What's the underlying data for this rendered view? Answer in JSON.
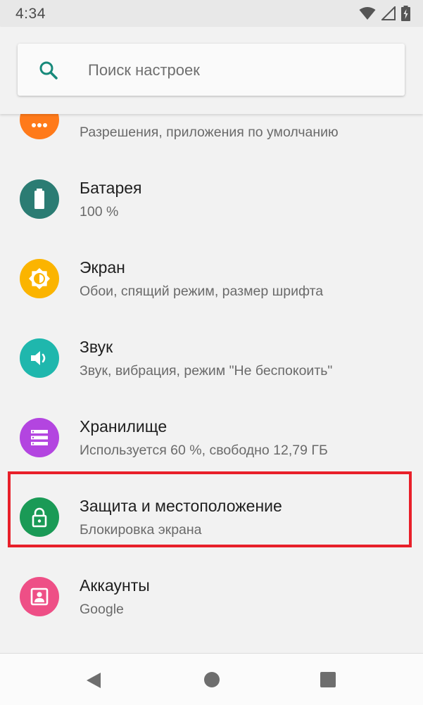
{
  "status_bar": {
    "time": "4:34",
    "icons": [
      "wifi-icon",
      "signal-icon",
      "battery-icon"
    ]
  },
  "search": {
    "placeholder": "Поиск настроек",
    "icon": "search-icon"
  },
  "items": [
    {
      "title": "",
      "subtitle": "Разрешения, приложения по умолчанию",
      "icon": "apps-icon",
      "color": "#ff7a1a"
    },
    {
      "title": "Батарея",
      "subtitle": "100 %",
      "icon": "battery-icon",
      "color": "#2b7c73"
    },
    {
      "title": "Экран",
      "subtitle": "Обои, спящий режим, размер шрифта",
      "icon": "brightness-icon",
      "color": "#fbb400"
    },
    {
      "title": "Звук",
      "subtitle": "Звук, вибрация, режим \"Не беспокоить\"",
      "icon": "volume-icon",
      "color": "#1fb7ad"
    },
    {
      "title": "Хранилище",
      "subtitle": "Используется 60 %, свободно 12,79 ГБ",
      "icon": "storage-icon",
      "color": "#b345e0"
    },
    {
      "title": "Защита и местоположение",
      "subtitle": "Блокировка экрана",
      "icon": "lock-icon",
      "color": "#1a9a56"
    },
    {
      "title": "Аккаунты",
      "subtitle": "Google",
      "icon": "account-icon",
      "color": "#ee4f86"
    },
    {
      "title": "",
      "subtitle": "",
      "icon": "accessibility-icon",
      "color": "#4a28c0"
    }
  ],
  "highlight_color": "#e8202a",
  "nav_bar": {
    "buttons": [
      "back-icon",
      "home-icon",
      "recents-icon"
    ]
  }
}
